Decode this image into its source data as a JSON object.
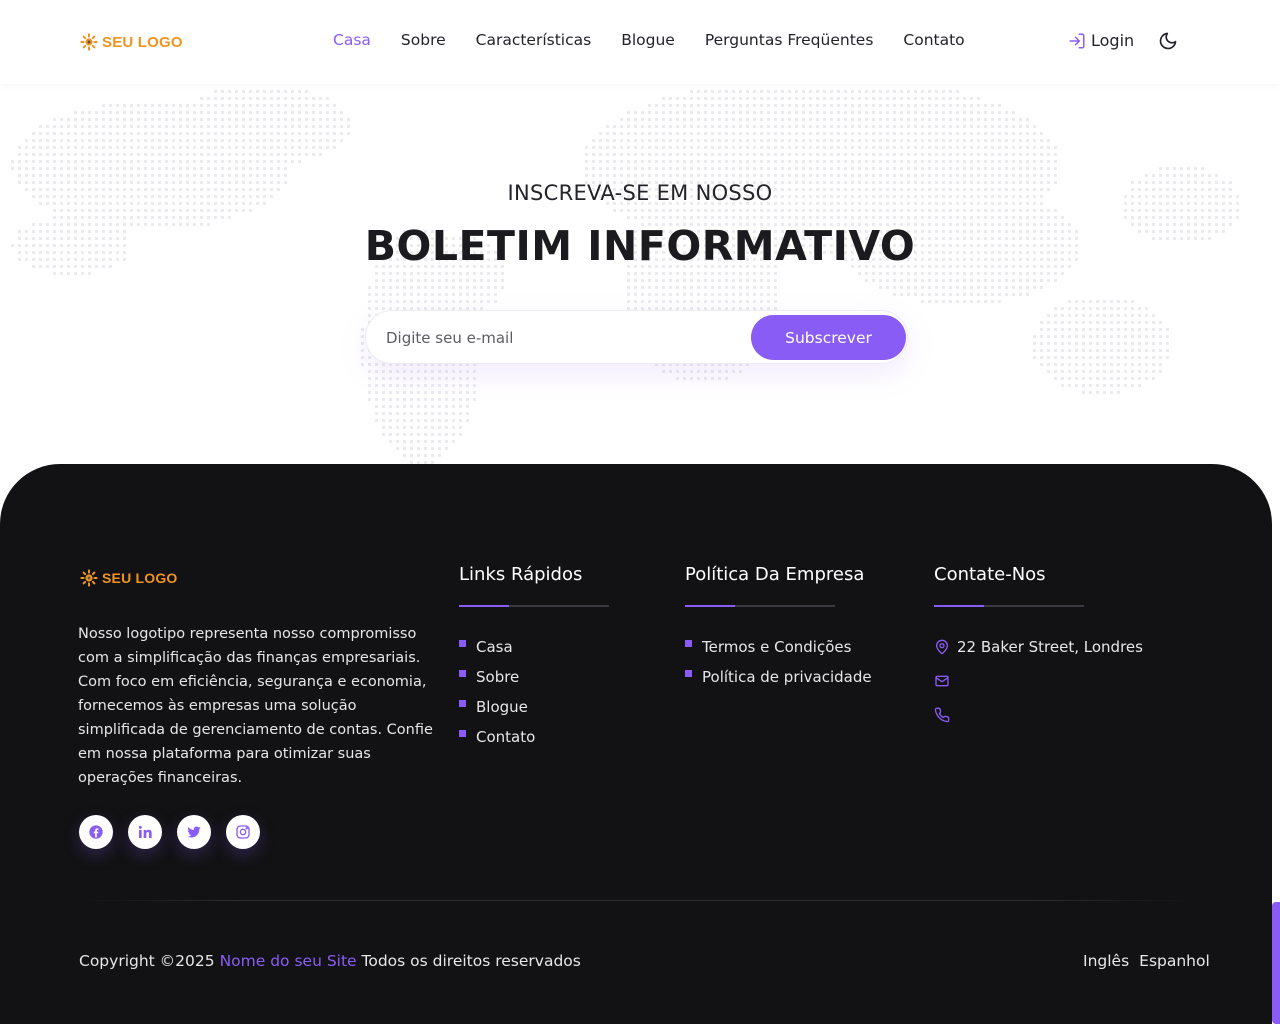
{
  "header": {
    "logo_text": "SEU LOGO",
    "nav": [
      {
        "label": "Casa",
        "active": true
      },
      {
        "label": "Sobre",
        "active": false
      },
      {
        "label": "Características",
        "active": false
      },
      {
        "label": "Blogue",
        "active": false
      },
      {
        "label": "Perguntas Freqüentes",
        "active": false
      },
      {
        "label": "Contato",
        "active": false
      }
    ],
    "login_label": "Login",
    "theme_toggle_icon": "moon-icon"
  },
  "newsletter": {
    "subtitle": "INSCREVA-SE EM NOSSO",
    "title": "BOLETIM INFORMATIVO",
    "email_placeholder": "Digite seu e-mail",
    "subscribe_label": "Subscrever"
  },
  "footer": {
    "logo_text": "SEU LOGO",
    "about": "Nosso logotipo representa nosso compromisso com a simplificação das finanças empresariais. Com foco em eficiência, segurança e economia, fornecemos às empresas uma solução simplificada de gerenciamento de contas. Confie em nossa plataforma para otimizar suas operações financeiras.",
    "socials": [
      "facebook-icon",
      "linkedin-icon",
      "twitter-icon",
      "instagram-icon"
    ],
    "quick_links": {
      "title": "Links Rápidos",
      "items": [
        "Casa",
        "Sobre",
        "Blogue",
        "Contato"
      ]
    },
    "company_policy": {
      "title": "Política Da Empresa",
      "items": [
        "Termos e Condições",
        "Política de privacidade"
      ]
    },
    "contact": {
      "title": "Contate-Nos",
      "address": "22 Baker Street, Londres",
      "email": "",
      "phone": ""
    },
    "copyright": {
      "prefix": "Copyright ©2025",
      "site_name": "Nome do seu Site",
      "suffix": "Todos os direitos reservados"
    },
    "languages": [
      "Inglês",
      "Espanhol"
    ]
  },
  "colors": {
    "accent": "#8a5cf6",
    "logo": "#f0941f",
    "footer_bg": "#121214"
  }
}
